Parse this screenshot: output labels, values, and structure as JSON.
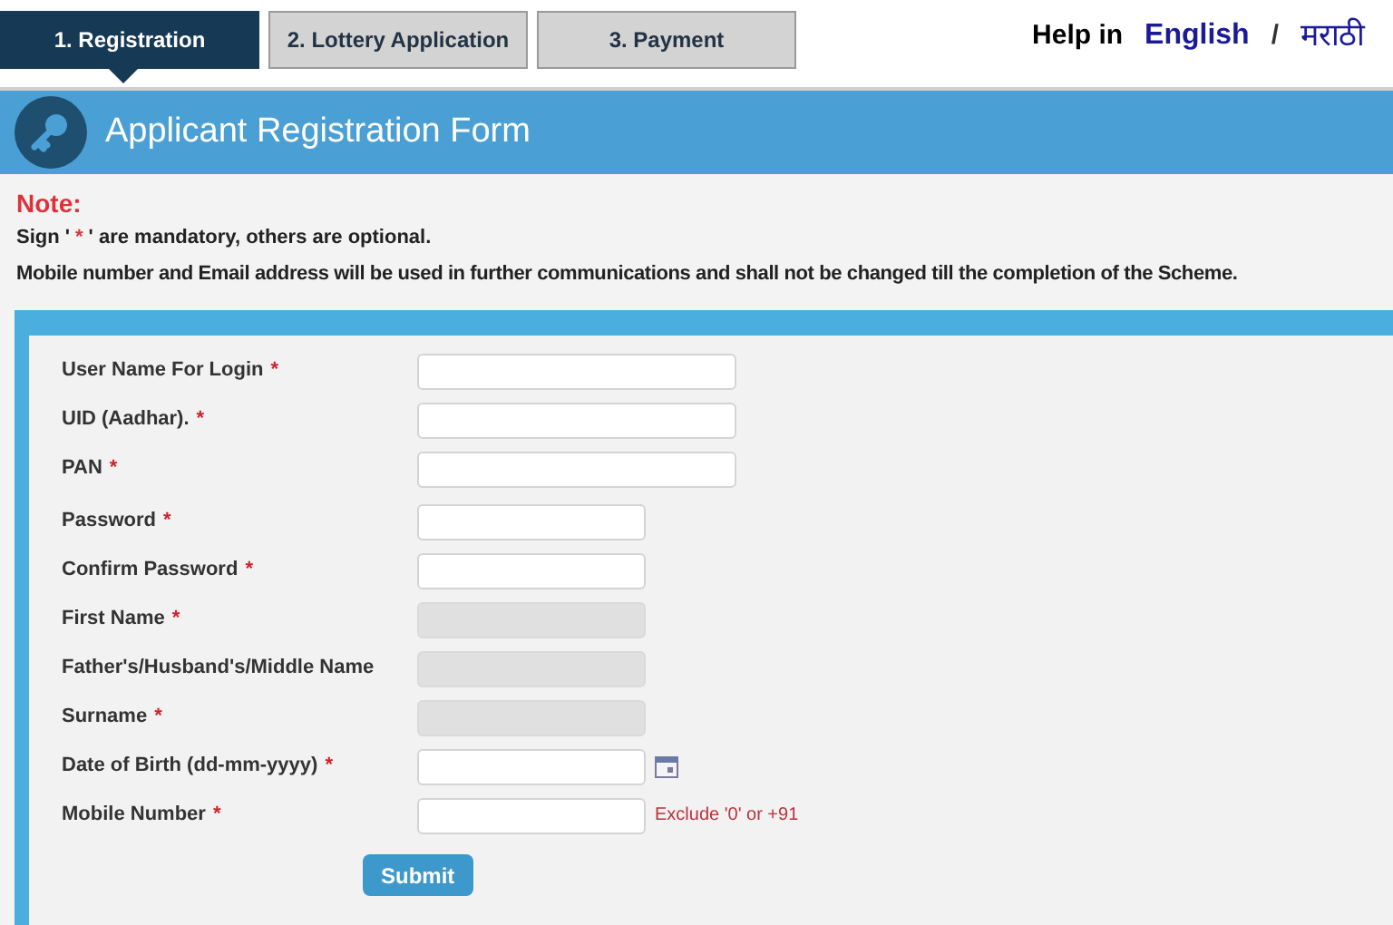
{
  "steps": [
    {
      "label": "1. Registration",
      "selected": true
    },
    {
      "label": "2. Lottery Application",
      "selected": false
    },
    {
      "label": "3. Payment",
      "selected": false
    }
  ],
  "help": {
    "label": "Help in",
    "languages": [
      "English",
      "मराठी"
    ],
    "separator": "/"
  },
  "header": {
    "title": "Applicant Registration Form"
  },
  "note": {
    "title": "Note:",
    "mandatory": {
      "before": "Sign '",
      "mark": "*",
      "after": "' are mandatory, others are optional."
    },
    "text": "Mobile number and Email address will be used in further communications and shall not be changed till the completion of the Scheme."
  },
  "form": {
    "groups": [
      [
        {
          "label": "User Name For Login",
          "mark": "*",
          "kind": "long",
          "disabled": false
        },
        {
          "label": "UID (Aadhar).",
          "mark": "*",
          "kind": "long",
          "disabled": false
        },
        {
          "label": "PAN",
          "mark": "*",
          "kind": "long",
          "disabled": false
        }
      ],
      [
        {
          "label": "Password",
          "mark": "*",
          "kind": "short",
          "disabled": false
        },
        {
          "label": "Confirm Password",
          "mark": "*",
          "kind": "short",
          "disabled": false
        },
        {
          "label": "First Name",
          "mark": "*",
          "kind": "short",
          "disabled": true
        },
        {
          "label": "Father's/Husband's/Middle Name",
          "kind": "short",
          "disabled": true
        },
        {
          "label": "Surname",
          "mark": "*",
          "kind": "short",
          "disabled": true
        },
        {
          "label": "Date of Birth (dd-mm-yyyy)",
          "mark": "*",
          "kind": "date",
          "disabled": false
        },
        {
          "label": "Mobile Number",
          "mark": "*",
          "kind": "short",
          "disabled": false,
          "hint": "Exclude '0' or +91"
        }
      ]
    ],
    "submit": "Submit"
  }
}
